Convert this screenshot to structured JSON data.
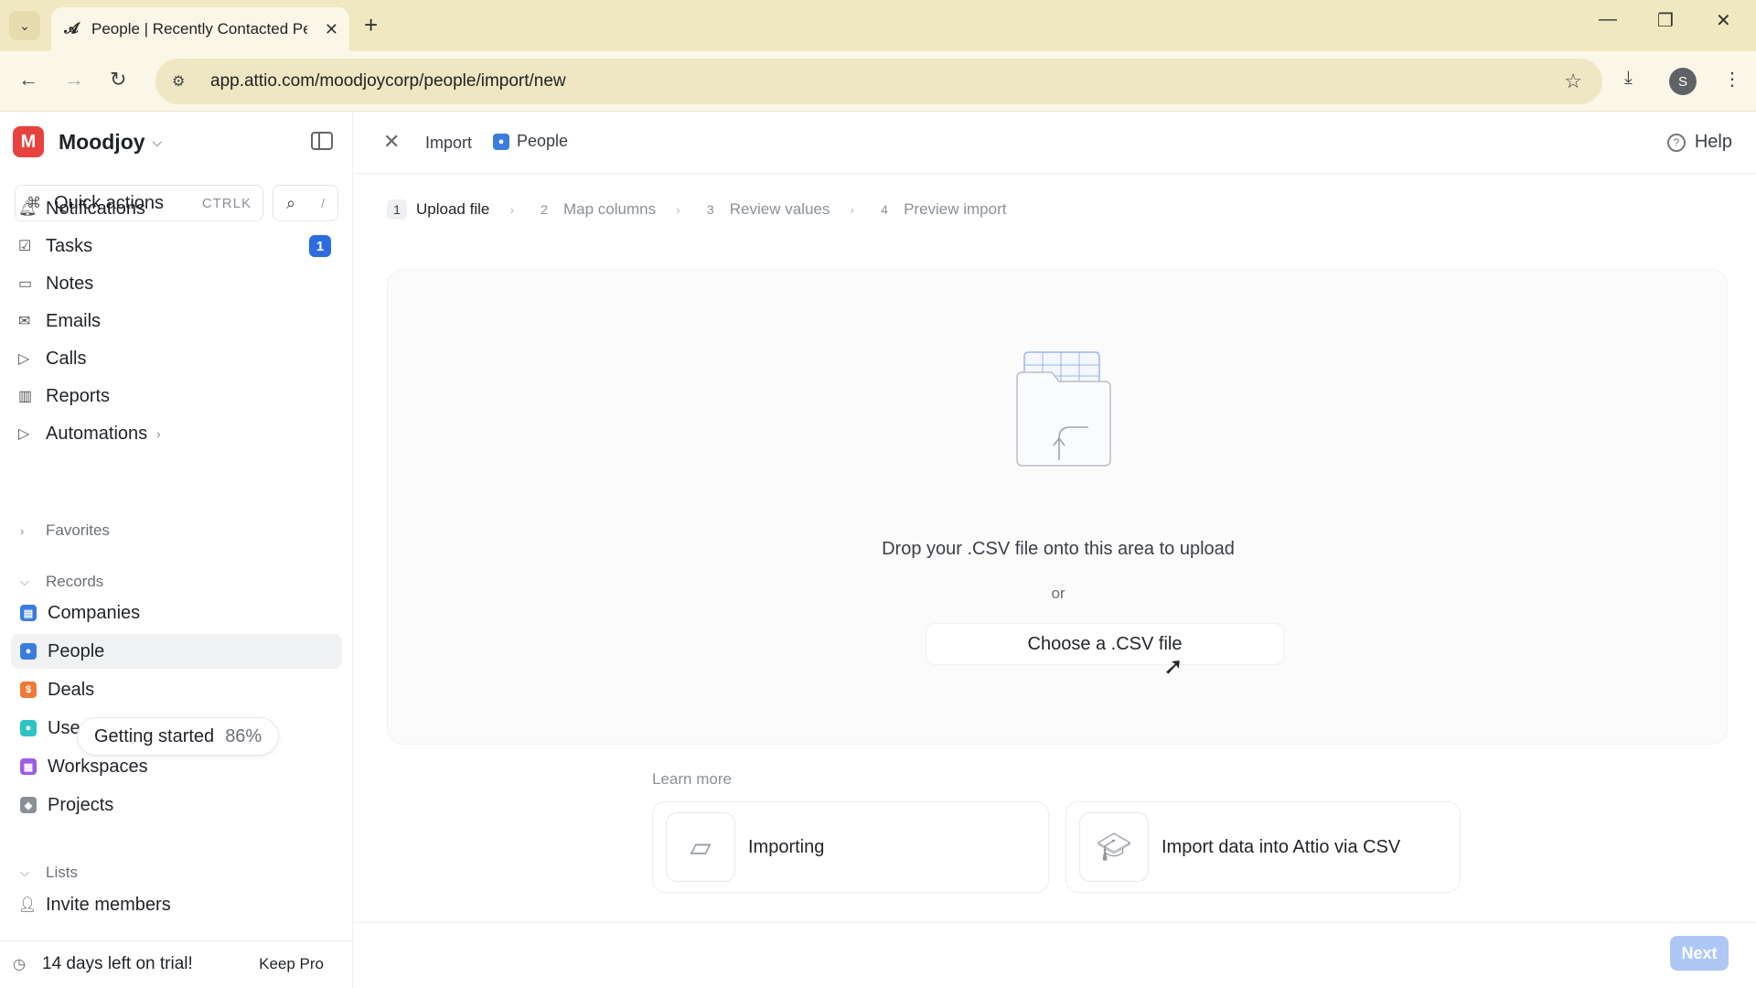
{
  "browser": {
    "tab_title": "People | Recently Contacted Pe",
    "url": "app.attio.com/moodjoycorp/people/import/new",
    "profile_initial": "S"
  },
  "workspace": {
    "initial": "M",
    "name": "Moodjoy"
  },
  "sidebar": {
    "quick_actions": {
      "label": "Quick actions",
      "shortcut": "CTRLK"
    },
    "search_shortcut": "/",
    "nav": [
      {
        "label": "Notifications",
        "icon": "bell-icon"
      },
      {
        "label": "Tasks",
        "icon": "check-square-icon",
        "badge": "1"
      },
      {
        "label": "Notes",
        "icon": "note-icon"
      },
      {
        "label": "Emails",
        "icon": "mail-icon"
      },
      {
        "label": "Calls",
        "icon": "video-icon"
      },
      {
        "label": "Reports",
        "icon": "chart-icon"
      },
      {
        "label": "Automations",
        "icon": "play-icon"
      }
    ],
    "favorites_label": "Favorites",
    "records_label": "Records",
    "records": [
      {
        "label": "Companies",
        "color": "#3b7ddd"
      },
      {
        "label": "People",
        "color": "#3b7ddd"
      },
      {
        "label": "Deals",
        "color": "#f07a36"
      },
      {
        "label": "Users",
        "color": "#2ec4c4"
      },
      {
        "label": "Workspaces",
        "color": "#9b5de5"
      },
      {
        "label": "Projects",
        "color": "#8a8f98"
      }
    ],
    "lists_label": "Lists",
    "getting_started": {
      "label": "Getting started",
      "percent": "86%"
    },
    "invite_members": "Invite members",
    "trial": {
      "text": "14 days left on trial!",
      "action": "Keep Pro"
    }
  },
  "main": {
    "breadcrumb": {
      "import": "Import",
      "people": "People"
    },
    "help": "Help",
    "steps": [
      {
        "num": "1",
        "label": "Upload file",
        "active": true
      },
      {
        "num": "2",
        "label": "Map columns",
        "active": false
      },
      {
        "num": "3",
        "label": "Review values",
        "active": false
      },
      {
        "num": "4",
        "label": "Preview import",
        "active": false
      }
    ],
    "dropzone": {
      "text": "Drop your .CSV file onto this area to upload",
      "or": "or",
      "button": "Choose a .CSV file"
    },
    "learn_more": {
      "label": "Learn more",
      "cards": [
        {
          "label": "Importing",
          "icon": "book-icon"
        },
        {
          "label": "Import data into Attio via CSV",
          "icon": "graduation-cap-icon"
        }
      ]
    },
    "next": "Next"
  }
}
